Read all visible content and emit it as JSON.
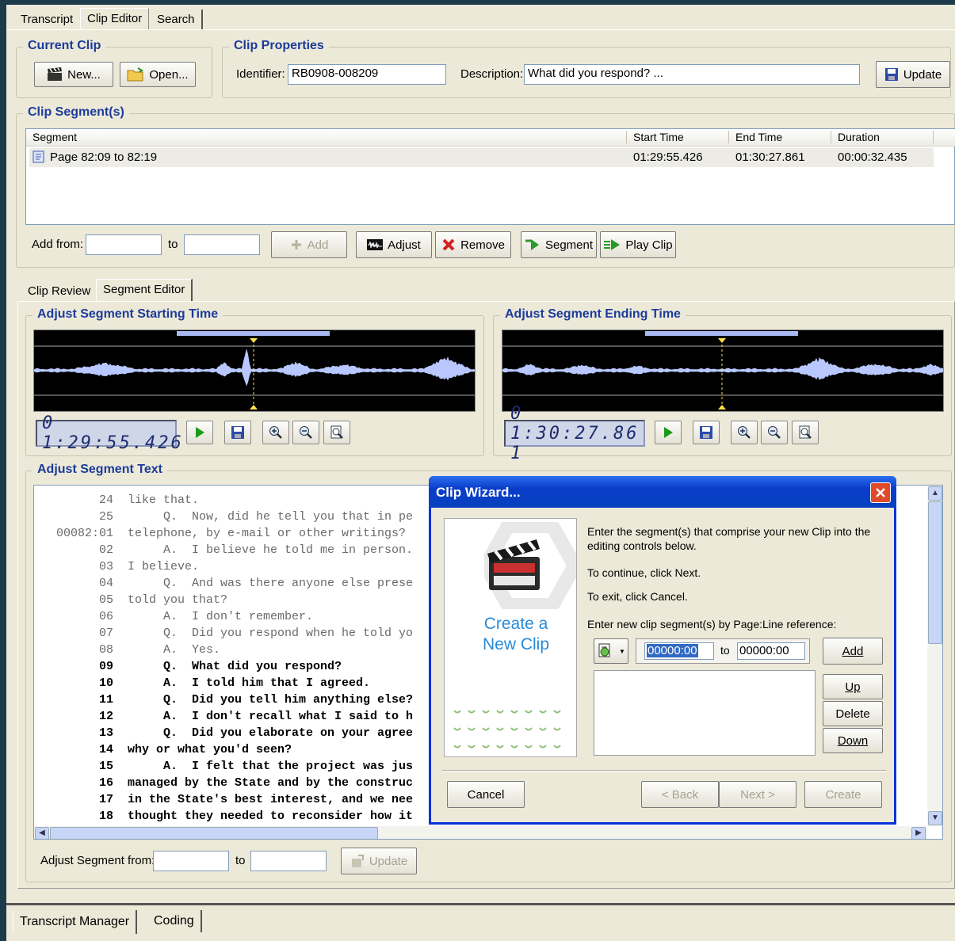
{
  "top_tabs": [
    "Transcript",
    "Clip Editor",
    "Search"
  ],
  "current_clip": {
    "title": "Current Clip",
    "new_label": "New...",
    "open_label": "Open..."
  },
  "clip_properties": {
    "title": "Clip Properties",
    "identifier_label": "Identifier:",
    "identifier_value": "RB0908-008209",
    "description_label": "Description:",
    "description_value": "What did you respond? ...",
    "update_label": "Update"
  },
  "clip_segments": {
    "title": "Clip Segment(s)",
    "columns": [
      "Segment",
      "Start Time",
      "End Time",
      "Duration"
    ],
    "rows": [
      {
        "segment": "Page 82:09 to 82:19",
        "start": "01:29:55.426",
        "end": "01:30:27.861",
        "duration": "00:00:32.435"
      }
    ],
    "add_from_label": "Add from:",
    "to_label": "to",
    "add_label": "Add",
    "adjust_label": "Adjust",
    "remove_label": "Remove",
    "segment_label": "Segment",
    "play_clip_label": "Play Clip"
  },
  "sub_tabs": [
    "Clip Review",
    "Segment Editor"
  ],
  "start_panel": {
    "title": "Adjust Segment Starting Time",
    "time": "01:29:55.426",
    "time_display": "0 1:29:55.426"
  },
  "end_panel": {
    "title": "Adjust Segment Ending Time",
    "time": "01:30:27.861",
    "time_display": "0 1:30:27.86 1"
  },
  "segment_text": {
    "title": "Adjust Segment Text",
    "lines": [
      {
        "n": "24",
        "t": "like that.",
        "b": false
      },
      {
        "n": "25",
        "t": "     Q.  Now, did he tell you that in pe",
        "b": false
      },
      {
        "n": "00082:01",
        "t": "telephone, by e-mail or other writings?",
        "b": false
      },
      {
        "n": "02",
        "t": "     A.  I believe he told me in person.",
        "b": false
      },
      {
        "n": "03",
        "t": "I believe.",
        "b": false
      },
      {
        "n": "04",
        "t": "     Q.  And was there anyone else prese",
        "b": false
      },
      {
        "n": "05",
        "t": "told you that?",
        "b": false
      },
      {
        "n": "06",
        "t": "     A.  I don't remember.",
        "b": false
      },
      {
        "n": "07",
        "t": "     Q.  Did you respond when he told yo",
        "b": false
      },
      {
        "n": "08",
        "t": "     A.  Yes.",
        "b": false
      },
      {
        "n": "09",
        "t": "     Q.  What did you respond?",
        "b": true
      },
      {
        "n": "10",
        "t": "     A.  I told him that I agreed.",
        "b": true
      },
      {
        "n": "11",
        "t": "     Q.  Did you tell him anything else?",
        "b": true
      },
      {
        "n": "12",
        "t": "     A.  I don't recall what I said to h",
        "b": true
      },
      {
        "n": "13",
        "t": "     Q.  Did you elaborate on your agree",
        "b": true
      },
      {
        "n": "14",
        "t": "why or what you'd seen?",
        "b": true
      },
      {
        "n": "15",
        "t": "     A.  I felt that the project was jus",
        "b": true
      },
      {
        "n": "16",
        "t": "managed by the State and by the construc",
        "b": true
      },
      {
        "n": "17",
        "t": "in the State's best interest, and we nee",
        "b": true
      },
      {
        "n": "18",
        "t": "thought they needed to reconsider how it",
        "b": true
      }
    ],
    "adjust_from_label": "Adjust Segment from:",
    "to_label": "to",
    "update_label": "Update"
  },
  "wizard": {
    "title": "Clip Wizard...",
    "banner": "Create a New Clip",
    "intro": "Enter the segment(s) that comprise your new Clip into the editing controls below.",
    "continue_text": "To continue, click Next.",
    "exit_text": "To exit, click Cancel.",
    "enter_label": "Enter new clip segment(s) by Page:Line reference:",
    "from_value": "00000:00",
    "to_label": "to",
    "to_value": "00000:00",
    "add_label": "Add",
    "up_label": "Up",
    "delete_label": "Delete",
    "down_label": "Down",
    "cancel_label": "Cancel",
    "back_label": "< Back",
    "next_label": "Next >",
    "create_label": "Create"
  },
  "bottom_tabs": [
    "Transcript Manager",
    "Coding"
  ],
  "colors": {
    "accent": "#1c3b9c",
    "title_bar": "#0a3cc8",
    "waveform": "#b8c8ff",
    "selection": "#a8b8f0",
    "cursor": "#ffe04a"
  }
}
